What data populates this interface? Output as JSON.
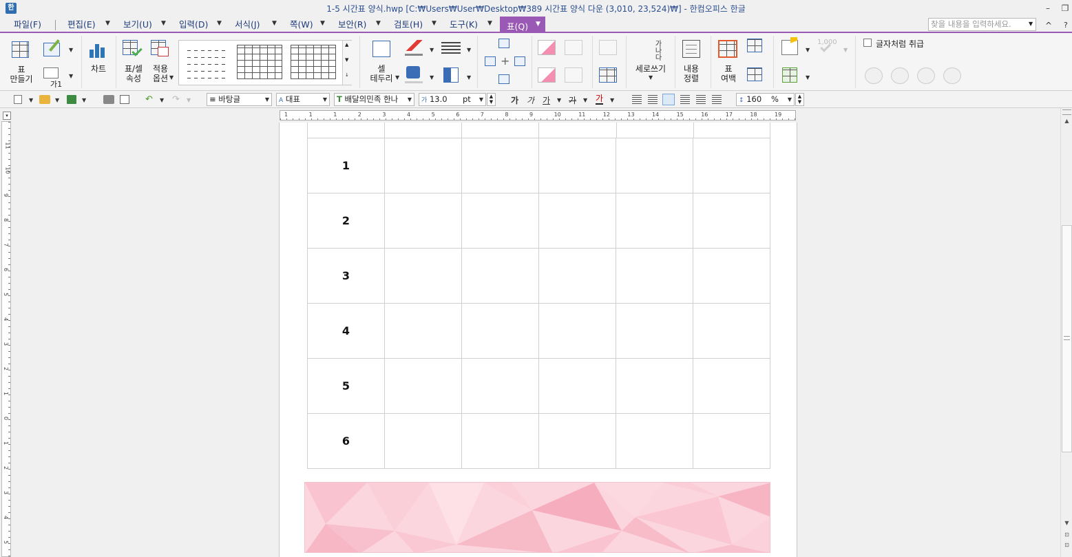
{
  "window": {
    "title": "1-5 시간표 양식.hwp [C:₩Users₩User₩Desktop₩389 시간표 양식 다운 (3,010, 23,524)₩] - 한컴오피스 한글",
    "controls": [
      "–",
      "❐"
    ]
  },
  "menu": {
    "items": [
      "파일(F)",
      "편집(E)",
      "보기(U)",
      "입력(D)",
      "서식(J)",
      "쪽(W)",
      "보안(R)",
      "검토(H)",
      "도구(K)"
    ],
    "active": "표(Q)",
    "search_placeholder": "찾을 내용을 입력하세요.",
    "help": "?",
    "collapse": "^"
  },
  "ribbon": {
    "make_table": "표\n만들기",
    "text_box_label": "가1",
    "chart": "차트",
    "table_cell_props": "표/셀\n속성",
    "apply_options": "적용\n옵션",
    "cell_border": "셀\n테두리",
    "vertical_text": "세로쓰기",
    "vertical_text_glyphs": "가나다",
    "content_align": "내용\n정렬",
    "table_margin": "표\n여백",
    "number_format": "1,000",
    "treat_as_char": "글자처럼 취급"
  },
  "format_bar": {
    "style": "바탕글",
    "language": "대표",
    "font": "배달의민족 한나",
    "font_size": "13.0",
    "size_unit": "pt",
    "bold": "가",
    "italic": "가",
    "underline": "가",
    "strike": "가",
    "color_char": "가",
    "line_spacing": "160",
    "spacing_unit": "%"
  },
  "rulers": {
    "h_labels": [
      "1",
      "1",
      "1",
      "2",
      "3",
      "4",
      "5",
      "6",
      "7",
      "8",
      "9",
      "10",
      "11",
      "12",
      "13",
      "14",
      "15",
      "16",
      "17",
      "18",
      "19"
    ],
    "v_labels": [
      "11",
      "10",
      "9",
      "8",
      "7",
      "6",
      "5",
      "4",
      "3",
      "2",
      "1",
      "0",
      "1",
      "2",
      "3",
      "4",
      "5"
    ]
  },
  "document": {
    "rows": [
      "1",
      "2",
      "3",
      "4",
      "5",
      "6"
    ]
  }
}
